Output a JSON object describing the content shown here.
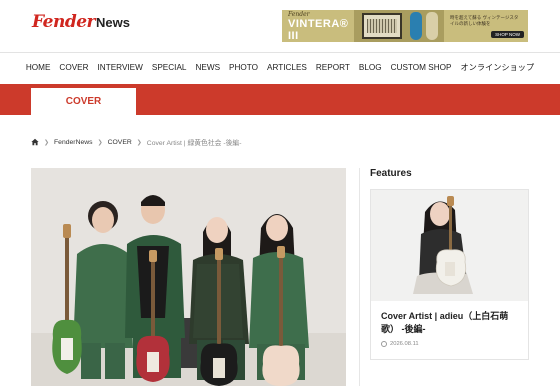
{
  "header": {
    "logo_script": "Fender",
    "logo_news": "News",
    "banner": {
      "brand": "Fender",
      "title": "VINTERA® III",
      "copy": "時を超えて蘇る ヴィンテージスタイルの新しい体験を",
      "shop_label": "SHOP NOW"
    }
  },
  "nav": {
    "items": [
      "HOME",
      "COVER",
      "INTERVIEW",
      "SPECIAL",
      "NEWS",
      "PHOTO",
      "ARTICLES",
      "REPORT",
      "BLOG",
      "CUSTOM SHOP",
      "オンラインショップ"
    ]
  },
  "section_tab": "COVER",
  "breadcrumb": {
    "items": [
      "FenderNews",
      "COVER"
    ],
    "current": "Cover Artist | 緑黄色社会 -後編-"
  },
  "sidebar": {
    "title": "Features",
    "card": {
      "title": "Cover Artist | adieu（上白石萌歌） -後編-",
      "date": "2026.08.11"
    }
  },
  "colors": {
    "brand_red": "#cc3a2b",
    "band_red": "#cc3a2b"
  },
  "icons": {
    "home": "home-icon",
    "chevron": "chevron-right-icon",
    "clock": "clock-icon"
  }
}
